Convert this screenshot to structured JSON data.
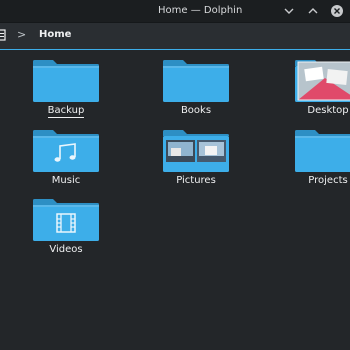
{
  "window": {
    "title": "Home — Dolphin"
  },
  "breadcrumb": {
    "separator": ">",
    "current": "Home"
  },
  "items": [
    {
      "label": "Backup",
      "icon": "folder-icon",
      "focused": true
    },
    {
      "label": "Books",
      "icon": "folder-icon"
    },
    {
      "label": "Desktop",
      "icon": "folder-desktop-icon"
    },
    {
      "label": "Music",
      "icon": "folder-music-icon"
    },
    {
      "label": "Pictures",
      "icon": "folder-pictures-icon"
    },
    {
      "label": "Projects",
      "icon": "folder-icon"
    },
    {
      "label": "Videos",
      "icon": "folder-videos-icon"
    }
  ],
  "colors": {
    "folder": "#3daee9",
    "folder_tab": "#2d8fc4",
    "background": "#232629",
    "accent": "#3daee9"
  }
}
